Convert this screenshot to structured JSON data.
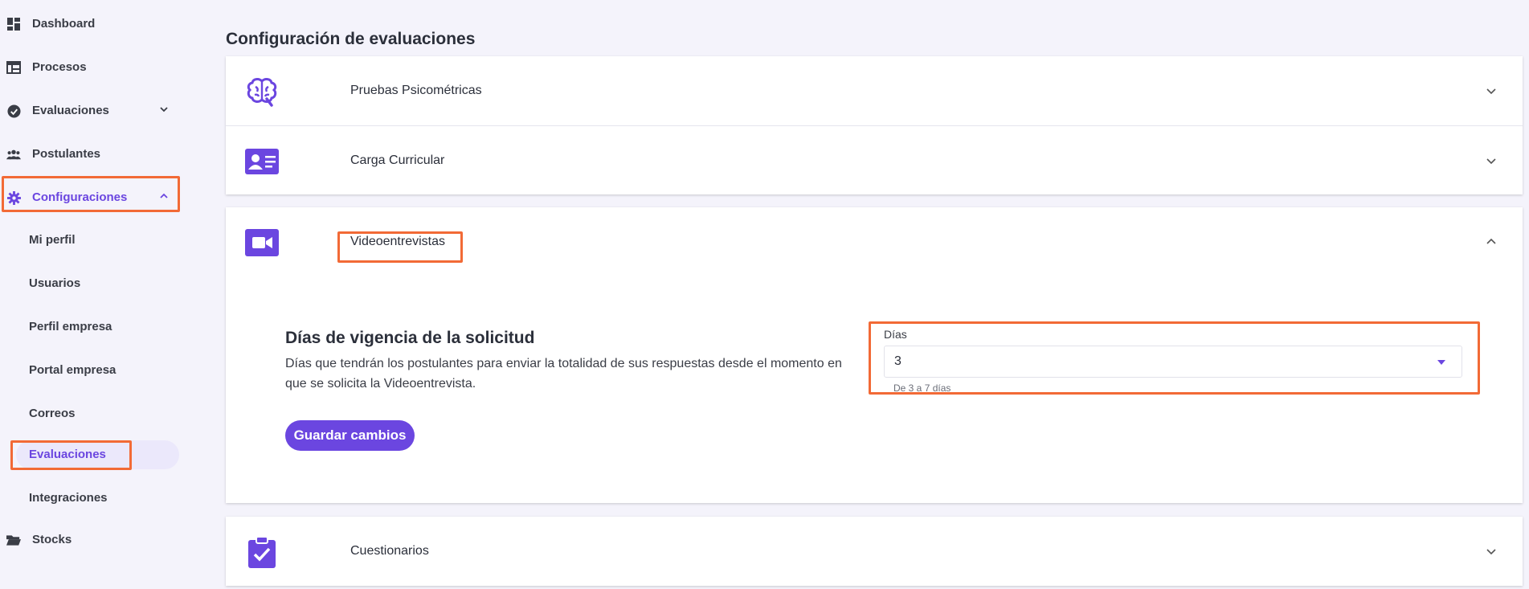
{
  "sidebar": {
    "items": [
      {
        "label": "Dashboard",
        "icon": "dashboard-icon"
      },
      {
        "label": "Procesos",
        "icon": "table-icon"
      },
      {
        "label": "Evaluaciones",
        "icon": "check-circle-icon"
      },
      {
        "label": "Postulantes",
        "icon": "people-icon"
      },
      {
        "label": "Configuraciones",
        "icon": "gear-icon"
      },
      {
        "label": "Stocks",
        "icon": "folder-icon"
      }
    ],
    "sub_items": [
      "Mi perfil",
      "Usuarios",
      "Perfil empresa",
      "Portal empresa",
      "Correos",
      "Evaluaciones",
      "Integraciones"
    ],
    "accent_color": "#6b46e0"
  },
  "main": {
    "title": "Configuración de evaluaciones",
    "panels": [
      {
        "label": "Pruebas Psicométricas",
        "icon": "brain-icon"
      },
      {
        "label": "Carga Curricular",
        "icon": "id-card-icon"
      },
      {
        "label": "Videoentrevistas",
        "icon": "video-camera-icon"
      },
      {
        "label": "Cuestionarios",
        "icon": "clipboard-check-icon"
      }
    ],
    "video": {
      "heading": "Días de vigencia de la solicitud",
      "description": "Días que tendrán los postulantes para enviar la totalidad de sus respuestas desde el momento en que se solicita la Videoentrevista.",
      "field_label": "Días",
      "field_value": "3",
      "helper": "De 3 a 7 días",
      "save_label": "Guardar cambios"
    }
  },
  "highlight_color": "#f26a36"
}
